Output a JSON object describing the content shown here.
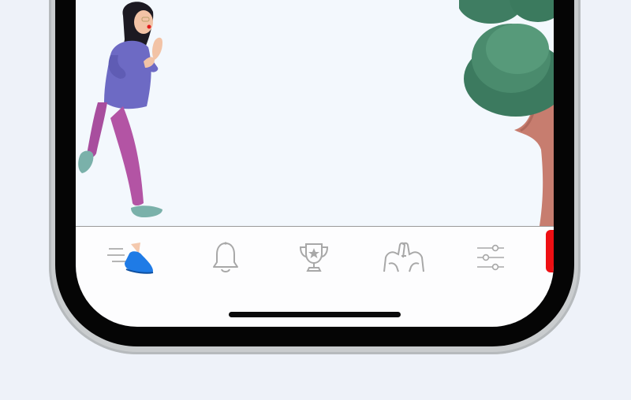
{
  "app": {
    "illustration": {
      "figure": "running-woman",
      "scenery": "tree"
    },
    "tabbar": {
      "tabs": [
        {
          "id": "run",
          "icon": "running-shoe-icon",
          "active": true
        },
        {
          "id": "notifications",
          "icon": "bell-icon",
          "active": false
        },
        {
          "id": "achievements",
          "icon": "trophy-star-icon",
          "active": false
        },
        {
          "id": "community",
          "icon": "pinky-promise-hands-icon",
          "active": false
        },
        {
          "id": "settings",
          "icon": "sliders-icon",
          "active": false
        }
      ]
    },
    "colors": {
      "active_icon": "#1f7be6",
      "inactive_icon": "#a8a8a8",
      "side_badge": "#ee0f13",
      "scene_background": "#f3f8fd"
    }
  }
}
